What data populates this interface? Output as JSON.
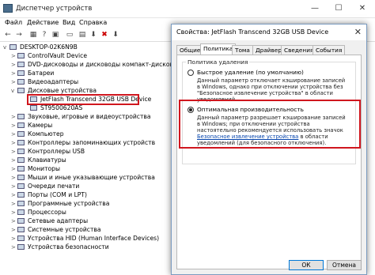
{
  "background_window": {
    "title": "Диспетчер устройств",
    "menu": [
      "Файл",
      "Действие",
      "Вид",
      "Справка"
    ],
    "tree": {
      "root": "DESKTOP-02K6N9B",
      "items": [
        {
          "label": "ControlVault Device"
        },
        {
          "label": "DVD-дисководы и дисководы компакт-дисков"
        },
        {
          "label": "Батареи"
        },
        {
          "label": "Видеоадаптеры"
        },
        {
          "label": "Дисковые устройства"
        },
        {
          "label": "JetFlash Transcend 32GB USB Device",
          "child": true,
          "highlight": true
        },
        {
          "label": "ST9500620AS",
          "child": true
        },
        {
          "label": "Звуковые, игровые и видеоустройства"
        },
        {
          "label": "Камеры"
        },
        {
          "label": "Компьютер"
        },
        {
          "label": "Контроллеры запоминающих устройств"
        },
        {
          "label": "Контроллеры USB"
        },
        {
          "label": "Клавиатуры"
        },
        {
          "label": "Мониторы"
        },
        {
          "label": "Мыши и иные указывающие устройства"
        },
        {
          "label": "Очереди печати"
        },
        {
          "label": "Порты (COM и LPT)"
        },
        {
          "label": "Программные устройства"
        },
        {
          "label": "Процессоры"
        },
        {
          "label": "Сетевые адаптеры"
        },
        {
          "label": "Системные устройства"
        },
        {
          "label": "Устройства HID (Human Interface Devices)"
        },
        {
          "label": "Устройства безопасности"
        }
      ]
    }
  },
  "dialog": {
    "title": "Свойства: JetFlash Transcend 32GB USB Device",
    "close_glyph": "✕",
    "tabs": [
      "Общие",
      "Политика",
      "Тома",
      "Драйвер",
      "Сведения",
      "События"
    ],
    "active_tab": "Политика",
    "group_title": "Политика удаления",
    "option_quick": {
      "label": "Быстрое удаление (по умолчанию)",
      "desc": "Данный параметр отключает кэширование записей в Windows, однако при отключении устройства без \"Безопасное извлечение устройства\" в области уведомлений."
    },
    "option_perf": {
      "label": "Оптимальная производительность",
      "desc_pre": "Данный параметр разрешает кэширование записей в Windows; при отключении устройства настоятельно рекомендуется использовать значок",
      "desc_link": "Безопасное извлечение устройства",
      "desc_post": "в области уведомлений (для безопасного отключения)."
    },
    "selected": "perf",
    "buttons": {
      "ok": "ОК",
      "cancel": "Отмена"
    }
  },
  "colors": {
    "highlight": "#d0161e",
    "link": "#0645ad",
    "dialog_border": "#7a9bc0"
  }
}
